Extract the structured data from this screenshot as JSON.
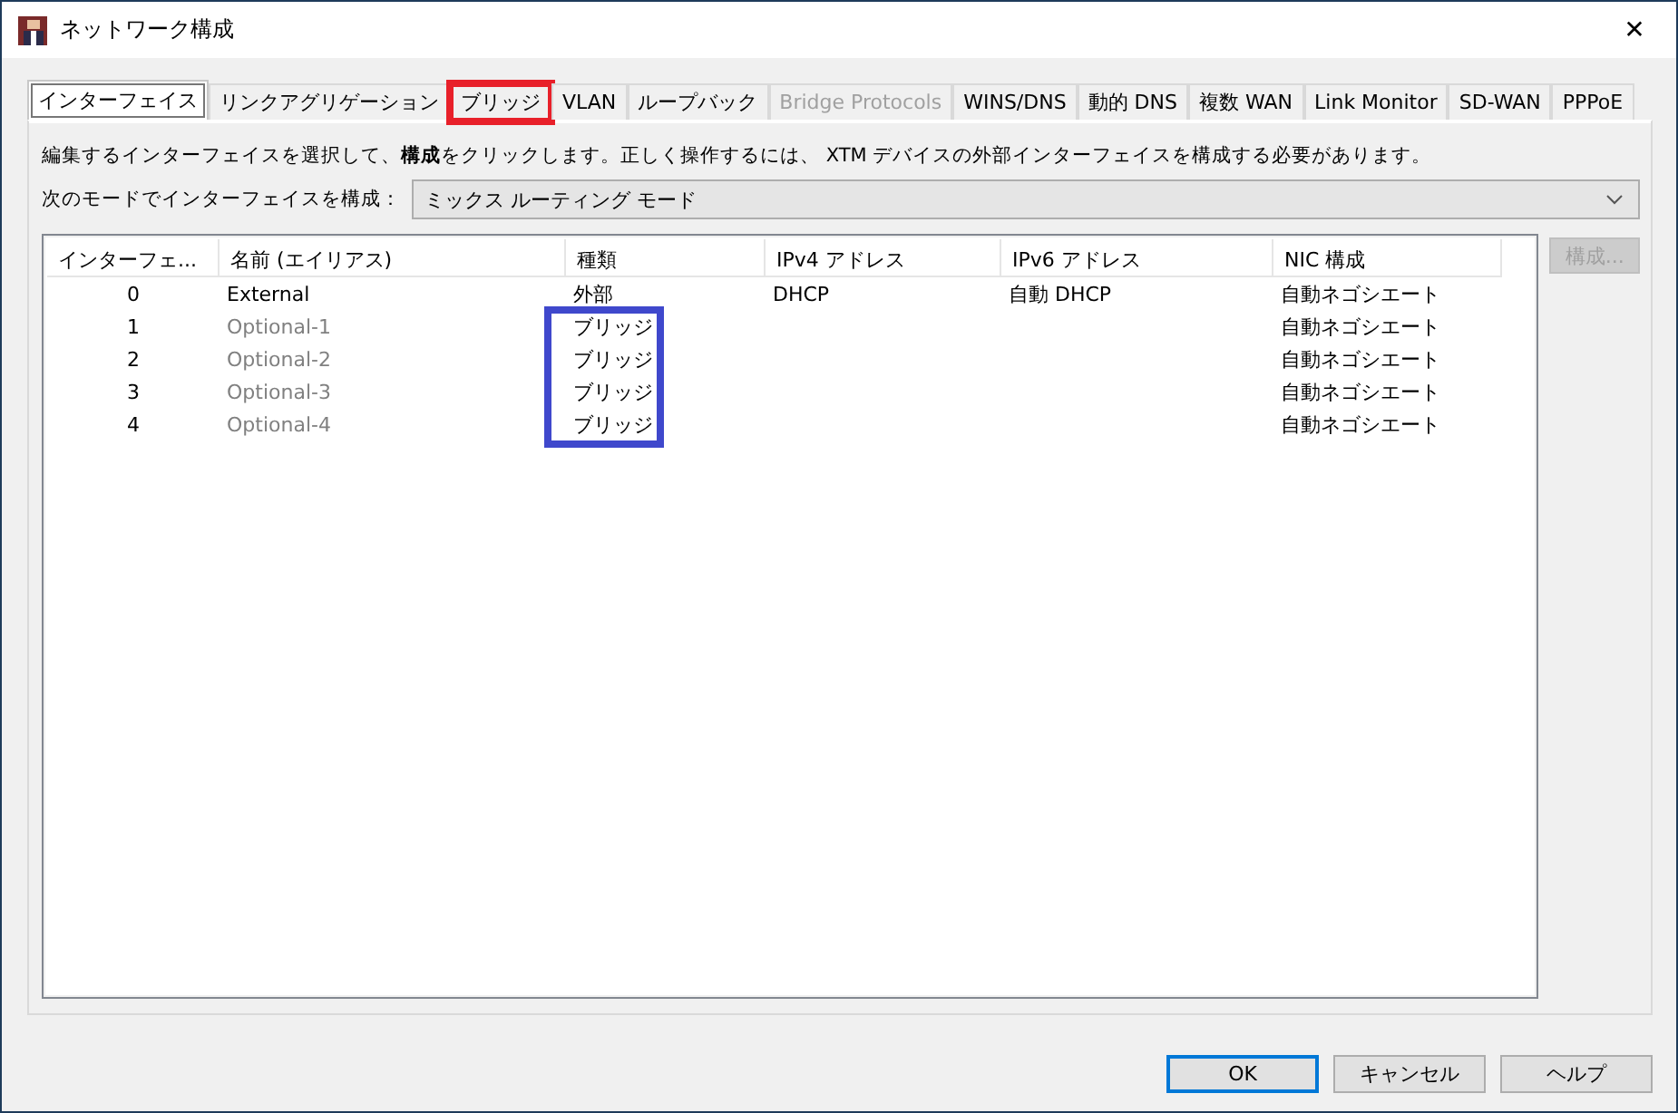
{
  "window": {
    "title": "ネットワーク構成",
    "close": "✕"
  },
  "tabs": [
    {
      "label": "インターフェイス",
      "selected": true,
      "disabled": false,
      "highlighted": false
    },
    {
      "label": "リンクアグリゲーション",
      "selected": false,
      "disabled": false,
      "highlighted": false
    },
    {
      "label": "ブリッジ",
      "selected": false,
      "disabled": false,
      "highlighted": true
    },
    {
      "label": "VLAN",
      "selected": false,
      "disabled": false,
      "highlighted": false
    },
    {
      "label": "ループバック",
      "selected": false,
      "disabled": false,
      "highlighted": false
    },
    {
      "label": "Bridge Protocols",
      "selected": false,
      "disabled": true,
      "highlighted": false
    },
    {
      "label": "WINS/DNS",
      "selected": false,
      "disabled": false,
      "highlighted": false
    },
    {
      "label": "動的 DNS",
      "selected": false,
      "disabled": false,
      "highlighted": false
    },
    {
      "label": "複数 WAN",
      "selected": false,
      "disabled": false,
      "highlighted": false
    },
    {
      "label": "Link Monitor",
      "selected": false,
      "disabled": false,
      "highlighted": false
    },
    {
      "label": "SD-WAN",
      "selected": false,
      "disabled": false,
      "highlighted": false
    },
    {
      "label": "PPPoE",
      "selected": false,
      "disabled": false,
      "highlighted": false
    }
  ],
  "description": "編集するインターフェイスを選択して、**構成**をクリックします。正しく操作するには、 XTM デバイスの外部インターフェイスを構成する必要があります。",
  "mode": {
    "label": "次のモードでインターフェイスを構成：",
    "value": "ミックス ルーティング モード"
  },
  "table": {
    "columns": [
      "インターフェ...",
      "名前 (エイリアス)",
      "種類",
      "IPv4 アドレス",
      "IPv6 アドレス",
      "NIC 構成"
    ],
    "rows": [
      {
        "cells": [
          "0",
          "External",
          "外部",
          "DHCP",
          "自動 DHCP",
          "自動ネゴシエート"
        ],
        "dimmed": false,
        "highlighted": false
      },
      {
        "cells": [
          "1",
          "Optional-1",
          "ブリッジ",
          null,
          null,
          "自動ネゴシエート"
        ],
        "dimmed": true,
        "highlighted": true
      },
      {
        "cells": [
          "2",
          "Optional-2",
          "ブリッジ",
          null,
          null,
          "自動ネゴシエート"
        ],
        "dimmed": true,
        "highlighted": true
      },
      {
        "cells": [
          "3",
          "Optional-3",
          "ブリッジ",
          null,
          null,
          "自動ネゴシエート"
        ],
        "dimmed": true,
        "highlighted": true
      },
      {
        "cells": [
          "4",
          "Optional-4",
          "ブリッジ",
          null,
          null,
          "自動ネゴシエート"
        ],
        "dimmed": true,
        "highlighted": true
      }
    ]
  },
  "configure_button": {
    "label": "構成...",
    "disabled": true
  },
  "buttons": [
    {
      "label": "OK",
      "default": true
    },
    {
      "label": "キャンセル",
      "default": false
    },
    {
      "label": "ヘルプ",
      "default": false
    }
  ]
}
